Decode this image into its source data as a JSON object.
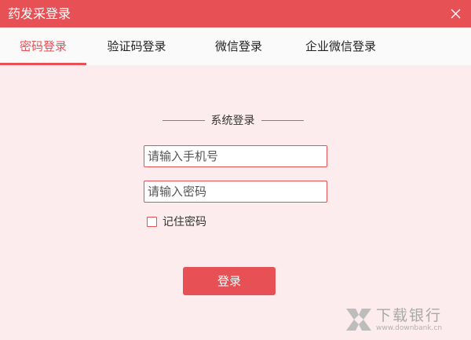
{
  "window": {
    "title": "药发采登录"
  },
  "tabs": [
    {
      "label": "密码登录",
      "active": true
    },
    {
      "label": "验证码登录",
      "active": false
    },
    {
      "label": "微信登录",
      "active": false
    },
    {
      "label": "企业微信登录",
      "active": false
    }
  ],
  "form": {
    "section_title": "系统登录",
    "phone_placeholder": "请输入手机号",
    "password_placeholder": "请输入密码",
    "remember_label": "记住密码",
    "remember_checked": false,
    "login_label": "登录"
  },
  "watermark": {
    "text": "下载银行",
    "url": "www.downbank.cn"
  },
  "colors": {
    "accent": "#e75155",
    "background": "#fdeced",
    "tabbar": "#fafafa"
  }
}
